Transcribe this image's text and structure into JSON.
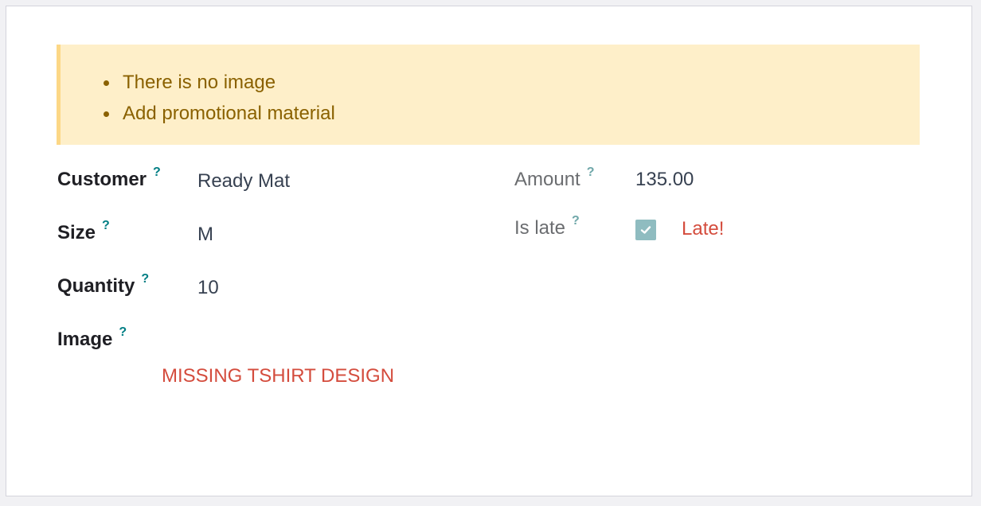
{
  "alert": {
    "items": [
      "There is no image",
      "Add promotional material"
    ]
  },
  "fields": {
    "customer": {
      "label": "Customer",
      "help": "?",
      "value": "Ready Mat"
    },
    "size": {
      "label": "Size",
      "help": "?",
      "value": "M"
    },
    "quantity": {
      "label": "Quantity",
      "help": "?",
      "value": "10"
    },
    "image": {
      "label": "Image",
      "help": "?",
      "value": "MISSING TSHIRT DESIGN"
    },
    "amount": {
      "label": "Amount",
      "help": "?",
      "value": "135.00"
    },
    "is_late": {
      "label": "Is late",
      "help": "?",
      "checked": true,
      "status": "Late!"
    }
  },
  "colors": {
    "alert_bg": "#feefc9",
    "alert_text": "#8a6100",
    "danger": "#d44c3d",
    "help": "#017e84",
    "checkbox": "#8fbcc0"
  },
  "icons": {
    "checkbox": "check-icon",
    "bullet": "bullet-icon"
  }
}
